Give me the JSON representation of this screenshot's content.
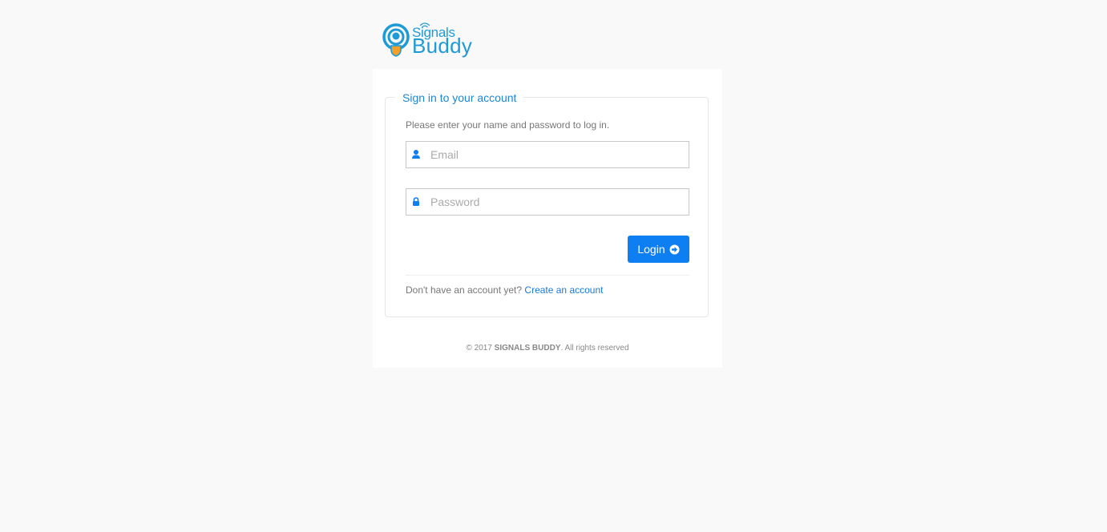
{
  "brand": {
    "logo_line1": "Signals",
    "logo_line2": "Buddy",
    "color": "#1e9ad6",
    "shield_color": "#f2a02b"
  },
  "form": {
    "legend": "Sign in to your account",
    "intro": "Please enter your name and password to log in.",
    "email_placeholder": "Email",
    "email_value": "",
    "email_icon": "user-icon",
    "password_placeholder": "Password",
    "password_value": "",
    "password_icon": "lock-icon",
    "login_label": "Login",
    "login_icon": "arrow-circle-right-icon",
    "accent": "#0d7ff2"
  },
  "signup": {
    "prompt": "Don't have an account yet?",
    "link_label": "Create an account"
  },
  "footer": {
    "prefix": "© 2017",
    "brand": "SIGNALS BUDDY",
    "suffix": ". All rights reserved"
  }
}
